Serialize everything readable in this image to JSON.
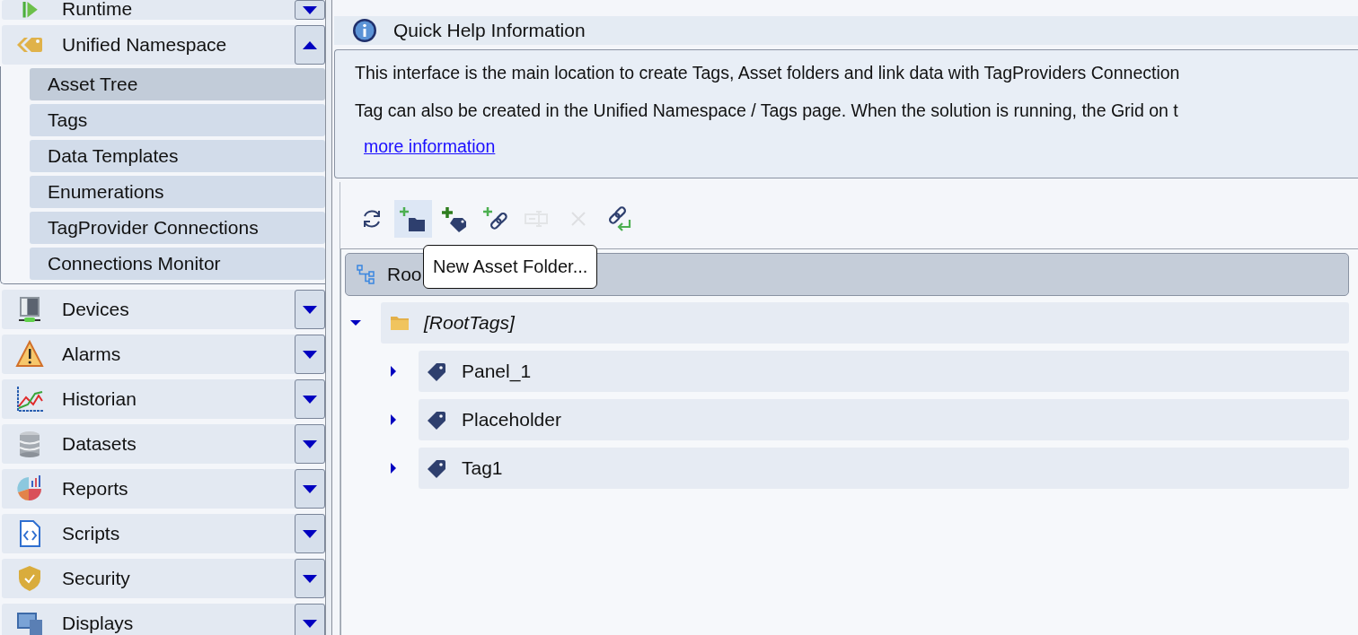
{
  "sidebar": {
    "sections": [
      {
        "label": "Runtime",
        "kind": "runtime",
        "expanded": false
      },
      {
        "label": "Unified Namespace",
        "kind": "namespace",
        "expanded": true,
        "children": [
          {
            "label": "Asset Tree",
            "selected": true
          },
          {
            "label": "Tags",
            "selected": false
          },
          {
            "label": "Data Templates",
            "selected": false
          },
          {
            "label": "Enumerations",
            "selected": false
          },
          {
            "label": "TagProvider Connections",
            "selected": false
          },
          {
            "label": "Connections Monitor",
            "selected": false
          }
        ]
      },
      {
        "label": "Devices",
        "kind": "devices",
        "expanded": false
      },
      {
        "label": "Alarms",
        "kind": "alarms",
        "expanded": false
      },
      {
        "label": "Historian",
        "kind": "historian",
        "expanded": false
      },
      {
        "label": "Datasets",
        "kind": "datasets",
        "expanded": false
      },
      {
        "label": "Reports",
        "kind": "reports",
        "expanded": false
      },
      {
        "label": "Scripts",
        "kind": "scripts",
        "expanded": false
      },
      {
        "label": "Security",
        "kind": "security",
        "expanded": false
      },
      {
        "label": "Displays",
        "kind": "displays",
        "expanded": false
      }
    ]
  },
  "quick_help": {
    "title": "Quick Help Information",
    "lines": [
      "This interface is the main location to create Tags, Asset folders and link data with TagProviders Connection",
      "Tag can also be created in the Unified Namespace / Tags page. When the solution is running, the Grid on t"
    ],
    "link": "more information"
  },
  "toolbar": {
    "buttons": [
      {
        "kind": "refresh",
        "disabled": false,
        "highlighted": false
      },
      {
        "kind": "new-folder",
        "disabled": false,
        "highlighted": true
      },
      {
        "kind": "new-tag",
        "disabled": false,
        "highlighted": false
      },
      {
        "kind": "new-link",
        "disabled": false,
        "highlighted": false
      },
      {
        "kind": "rename",
        "disabled": true,
        "highlighted": false
      },
      {
        "kind": "delete",
        "disabled": true,
        "highlighted": false
      },
      {
        "kind": "relink",
        "disabled": false,
        "highlighted": false
      }
    ]
  },
  "tooltip": {
    "text": "New Asset Folder..."
  },
  "tree": {
    "root": {
      "label": "Roo",
      "selected": true,
      "children": [
        {
          "label": "[RootTags]",
          "kind": "folder",
          "expanded": true,
          "selected": false,
          "children": [
            {
              "label": "Panel_1",
              "kind": "tag",
              "expanded": false,
              "selected": false
            },
            {
              "label": "Placeholder",
              "kind": "tag",
              "expanded": false,
              "selected": false
            },
            {
              "label": "Tag1",
              "kind": "tag",
              "expanded": false,
              "selected": false
            }
          ]
        }
      ]
    }
  }
}
